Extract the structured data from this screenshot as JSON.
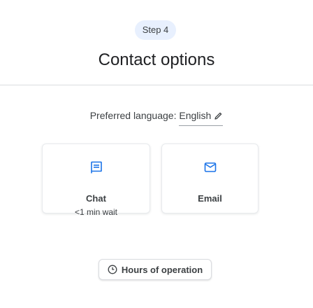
{
  "step": {
    "label": "Step 4"
  },
  "header": {
    "title": "Contact options"
  },
  "language": {
    "prefix": "Preferred language:",
    "value": "English",
    "edit_icon": "pencil-icon"
  },
  "options": [
    {
      "label": "Chat",
      "sub": "<1 min wait",
      "icon": "chat-icon"
    },
    {
      "label": "Email",
      "sub": "",
      "icon": "mail-icon"
    }
  ],
  "hours_button": {
    "label": "Hours of operation",
    "icon": "clock-icon"
  },
  "colors": {
    "accent": "#1a73e8",
    "pill_bg": "#e8f0fe",
    "text": "#202124",
    "divider": "#dadce0"
  }
}
